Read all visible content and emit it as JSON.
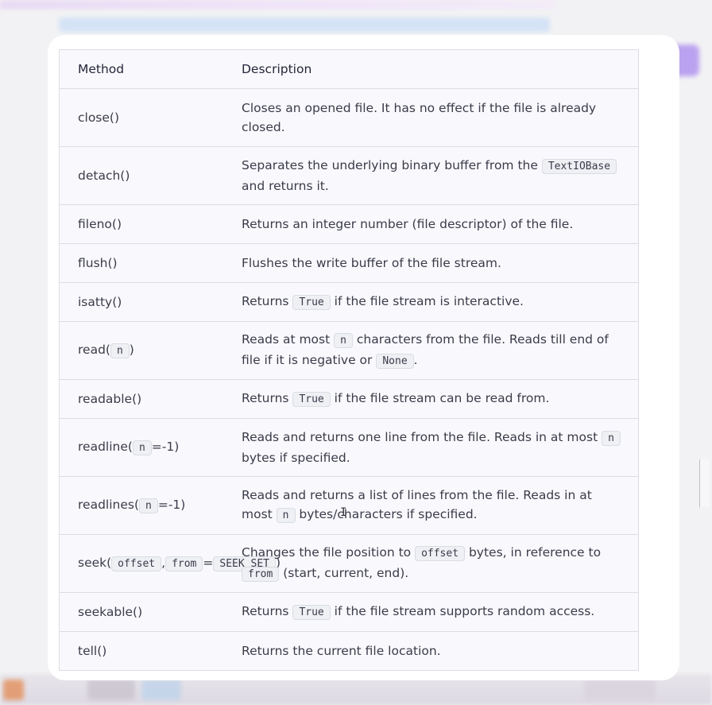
{
  "table": {
    "headers": {
      "method": "Method",
      "description": "Description"
    },
    "rows": [
      {
        "method": [
          "close()"
        ],
        "description": [
          "Closes an opened file. It has no effect if the file is already closed."
        ]
      },
      {
        "method": [
          "detach()"
        ],
        "description": [
          "Separates the underlying binary buffer from the ",
          {
            "code": "TextIOBase"
          },
          " and returns it."
        ]
      },
      {
        "method": [
          "fileno()"
        ],
        "description": [
          "Returns an integer number (file descriptor) of the file."
        ]
      },
      {
        "method": [
          "flush()"
        ],
        "description": [
          "Flushes the write buffer of the file stream."
        ]
      },
      {
        "method": [
          "isatty()"
        ],
        "description": [
          "Returns ",
          {
            "code": "True"
          },
          " if the file stream is interactive."
        ]
      },
      {
        "method": [
          "read(",
          {
            "code": "n"
          },
          ")"
        ],
        "description": [
          "Reads at most ",
          {
            "code": "n"
          },
          " characters from the file. Reads till end of file if it is negative or ",
          {
            "code": "None"
          },
          "."
        ]
      },
      {
        "method": [
          "readable()"
        ],
        "description": [
          "Returns ",
          {
            "code": "True"
          },
          " if the file stream can be read from."
        ]
      },
      {
        "method": [
          "readline(",
          {
            "code": "n"
          },
          "=-1)"
        ],
        "description": [
          "Reads and returns one line from the file. Reads in at most ",
          {
            "code": "n"
          },
          " bytes if specified."
        ]
      },
      {
        "method": [
          "readlines(",
          {
            "code": "n"
          },
          "=-1)"
        ],
        "description": [
          "Reads and returns a list of lines from the file. Reads in at most ",
          {
            "code": "n"
          },
          " bytes/characters if specified."
        ]
      },
      {
        "method": [
          "seek(",
          {
            "code": "offset"
          },
          ",",
          {
            "code": "from"
          },
          "=",
          {
            "code": "SEEK_SET"
          },
          ")"
        ],
        "description": [
          "Changes the file position to ",
          {
            "code": "offset"
          },
          " bytes, in reference to ",
          {
            "code": "from"
          },
          " (start, current, end)."
        ]
      },
      {
        "method": [
          "seekable()"
        ],
        "description": [
          "Returns ",
          {
            "code": "True"
          },
          " if the file stream supports random access."
        ]
      },
      {
        "method": [
          "tell()"
        ],
        "description": [
          "Returns the current file location."
        ]
      }
    ]
  }
}
